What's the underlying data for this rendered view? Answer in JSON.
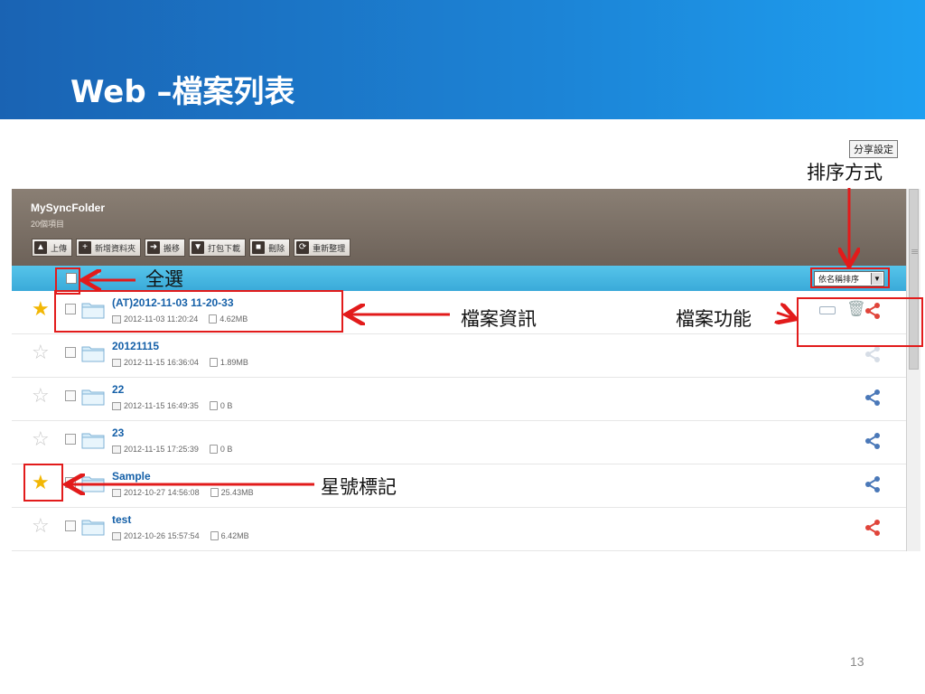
{
  "slide": {
    "title": "Web –檔案列表",
    "page_number": "13"
  },
  "app": {
    "folder_title": "MySyncFolder",
    "item_count": "20個項目",
    "toolbar": [
      {
        "label": "上傳",
        "icon": "upload-icon",
        "glyph": "▲"
      },
      {
        "label": "新增資料夾",
        "icon": "new-folder-icon",
        "glyph": "+"
      },
      {
        "label": "搬移",
        "icon": "move-icon",
        "glyph": "➜"
      },
      {
        "label": "打包下載",
        "icon": "download-icon",
        "glyph": "▼"
      },
      {
        "label": "刪除",
        "icon": "delete-icon",
        "glyph": "■"
      },
      {
        "label": "重新整理",
        "icon": "refresh-icon",
        "glyph": "⟳"
      }
    ],
    "sort_select": "依名稱排序",
    "tooltip": "分享設定",
    "files": [
      {
        "name": "(AT)2012-11-03 11-20-33",
        "date": "2012-11-03 11:20:24",
        "size": "4.62MB",
        "starred": true,
        "share_color": "#e0443a",
        "show_tools": true
      },
      {
        "name": "20121115",
        "date": "2012-11-15 16:36:04",
        "size": "1.89MB",
        "starred": false,
        "share_color": "#d6dde6",
        "show_tools": false
      },
      {
        "name": "22",
        "date": "2012-11-15 16:49:35",
        "size": "0 B",
        "starred": false,
        "share_color": "#4a78b8",
        "show_tools": false
      },
      {
        "name": "23",
        "date": "2012-11-15 17:25:39",
        "size": "0 B",
        "starred": false,
        "share_color": "#4a78b8",
        "show_tools": false
      },
      {
        "name": "Sample",
        "date": "2012-10-27 14:56:08",
        "size": "25.43MB",
        "starred": true,
        "share_color": "#4a78b8",
        "show_tools": false
      },
      {
        "name": "test",
        "date": "2012-10-26 15:57:54",
        "size": "6.42MB",
        "starred": false,
        "share_color": "#e0443a",
        "show_tools": false
      }
    ]
  },
  "callouts": {
    "sort": "排序方式",
    "select_all": "全選",
    "file_info": "檔案資訊",
    "file_functions": "檔案功能",
    "star_mark": "星號標記"
  },
  "colors": {
    "slide_header": "#1c84d6",
    "app_header": "#7a6f65",
    "list_header": "#45b6e2",
    "callout": "#e21b1b",
    "file_name": "#1560a8"
  }
}
